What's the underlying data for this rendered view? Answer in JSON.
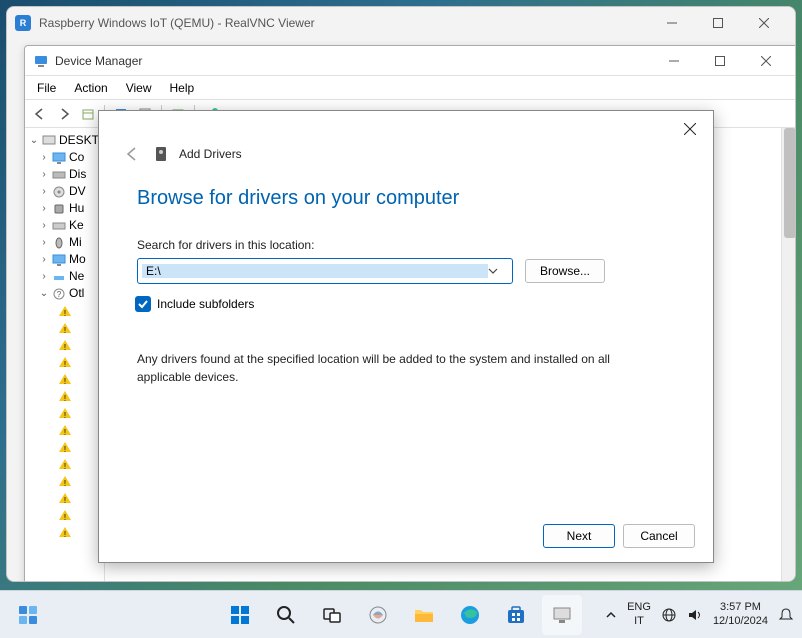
{
  "outer": {
    "title": "Raspberry Windows IoT (QEMU) - RealVNC Viewer",
    "app_icon_label": "R"
  },
  "dm": {
    "title": "Device Manager",
    "menu": {
      "file": "File",
      "action": "Action",
      "view": "View",
      "help": "Help"
    },
    "root": "DESKT",
    "nodes": [
      {
        "icon": "monitor",
        "label": "Co"
      },
      {
        "icon": "disk",
        "label": "Dis"
      },
      {
        "icon": "disc",
        "label": "DV"
      },
      {
        "icon": "hid",
        "label": "Hu"
      },
      {
        "icon": "keyboard",
        "label": "Ke"
      },
      {
        "icon": "mouse",
        "label": "Mi"
      },
      {
        "icon": "monitor",
        "label": "Mo"
      },
      {
        "icon": "network",
        "label": "Ne"
      },
      {
        "icon": "other",
        "label": "Otl"
      }
    ]
  },
  "dialog": {
    "title": "Add Drivers",
    "heading": "Browse for drivers on your computer",
    "field_label": "Search for drivers in this location:",
    "path_value": "E:\\",
    "browse": "Browse...",
    "include_subfolders": "Include subfolders",
    "description": "Any drivers found at the specified location will be added to the system and installed on all applicable devices.",
    "next": "Next",
    "cancel": "Cancel"
  },
  "taskbar": {
    "lang_top": "ENG",
    "lang_bottom": "IT",
    "time": "3:57 PM",
    "date": "12/10/2024"
  }
}
